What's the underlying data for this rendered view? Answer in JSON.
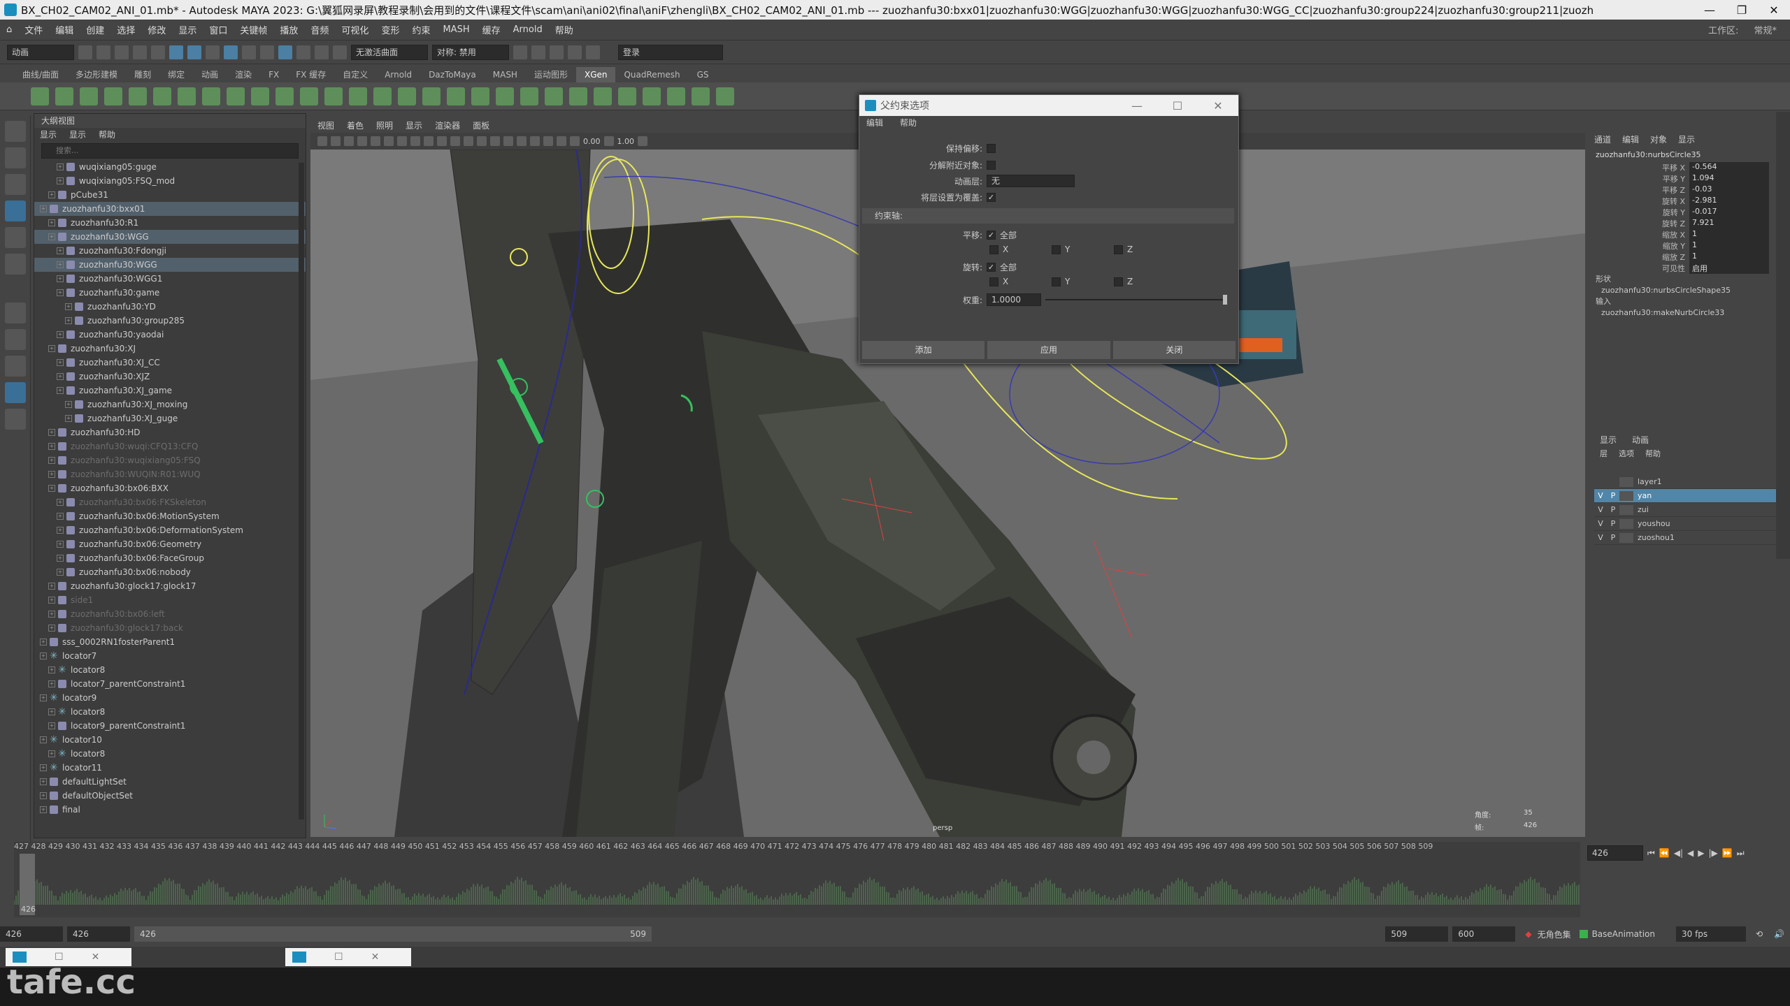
{
  "window": {
    "title": "BX_CH02_CAM02_ANI_01.mb* - Autodesk MAYA 2023: G:\\翼狐网录屏\\教程录制\\会用到的文件\\课程文件\\scam\\ani\\ani02\\final\\aniF\\zhengli\\BX_CH02_CAM02_ANI_01.mb --- zuozhanfu30:bxx01|zuozhanfu30:WGG|zuozhanfu30:WGG|zuozhanfu30:WGG_CC|zuozhanfu30:group224|zuozhanfu30:group211|zuozh",
    "controls": [
      "—",
      "❐",
      "✕"
    ]
  },
  "menubar": {
    "items": [
      "文件",
      "编辑",
      "创建",
      "选择",
      "修改",
      "显示",
      "窗口",
      "关键帧",
      "播放",
      "音频",
      "可视化",
      "变形",
      "约束",
      "MASH",
      "缓存",
      "Arnold",
      "帮助"
    ],
    "workspace_label": "工作区:",
    "workspace_value": "常规*"
  },
  "statusline": {
    "mode": "动画",
    "surface": "无激活曲面",
    "symmetry": "对称: 禁用",
    "login": "登录"
  },
  "shelf": {
    "tabs": [
      "曲线/曲面",
      "多边形建模",
      "雕刻",
      "绑定",
      "动画",
      "渲染",
      "FX",
      "FX 缓存",
      "自定义",
      "Arnold",
      "DazToMaya",
      "MASH",
      "运动图形",
      "XGen",
      "QuadRemesh",
      "GS"
    ],
    "active_tab": "XGen"
  },
  "outliner": {
    "title": "大纲视图",
    "menu": [
      "显示",
      "显示",
      "帮助"
    ],
    "search_placeholder": "搜索...",
    "items": [
      {
        "label": "wuqixiang05:guge",
        "indent": 2,
        "state": "normal"
      },
      {
        "label": "wuqixiang05:FSQ_mod",
        "indent": 2,
        "state": "normal"
      },
      {
        "label": "pCube31",
        "indent": 1,
        "state": "normal"
      },
      {
        "label": "zuozhanfu30:bxx01",
        "indent": 0,
        "state": "hl"
      },
      {
        "label": "zuozhanfu30:R1",
        "indent": 1,
        "state": "normal"
      },
      {
        "label": "zuozhanfu30:WGG",
        "indent": 1,
        "state": "hl"
      },
      {
        "label": "zuozhanfu30:Fdongji",
        "indent": 2,
        "state": "normal"
      },
      {
        "label": "zuozhanfu30:WGG",
        "indent": 2,
        "state": "hl"
      },
      {
        "label": "zuozhanfu30:WGG1",
        "indent": 2,
        "state": "normal"
      },
      {
        "label": "zuozhanfu30:game",
        "indent": 2,
        "state": "normal"
      },
      {
        "label": "zuozhanfu30:YD",
        "indent": 3,
        "state": "normal"
      },
      {
        "label": "zuozhanfu30:group285",
        "indent": 3,
        "state": "normal"
      },
      {
        "label": "zuozhanfu30:yaodai",
        "indent": 2,
        "state": "normal"
      },
      {
        "label": "zuozhanfu30:XJ",
        "indent": 1,
        "state": "normal"
      },
      {
        "label": "zuozhanfu30:XJ_CC",
        "indent": 2,
        "state": "normal"
      },
      {
        "label": "zuozhanfu30:XJZ",
        "indent": 2,
        "state": "normal"
      },
      {
        "label": "zuozhanfu30:XJ_game",
        "indent": 2,
        "state": "normal"
      },
      {
        "label": "zuozhanfu30:XJ_moxing",
        "indent": 3,
        "state": "normal"
      },
      {
        "label": "zuozhanfu30:XJ_guge",
        "indent": 3,
        "state": "normal"
      },
      {
        "label": "zuozhanfu30:HD",
        "indent": 1,
        "state": "normal"
      },
      {
        "label": "zuozhanfu30:wuqi:CFQ13:CFQ",
        "indent": 1,
        "state": "dim"
      },
      {
        "label": "zuozhanfu30:wuqixiang05:FSQ",
        "indent": 1,
        "state": "dim"
      },
      {
        "label": "zuozhanfu30:WUQIN:R01:WUQ",
        "indent": 1,
        "state": "dim"
      },
      {
        "label": "zuozhanfu30:bx06:BXX",
        "indent": 1,
        "state": "normal"
      },
      {
        "label": "zuozhanfu30:bx06:FKSkeleton",
        "indent": 2,
        "state": "dim"
      },
      {
        "label": "zuozhanfu30:bx06:MotionSystem",
        "indent": 2,
        "state": "normal"
      },
      {
        "label": "zuozhanfu30:bx06:DeformationSystem",
        "indent": 2,
        "state": "normal"
      },
      {
        "label": "zuozhanfu30:bx06:Geometry",
        "indent": 2,
        "state": "normal"
      },
      {
        "label": "zuozhanfu30:bx06:FaceGroup",
        "indent": 2,
        "state": "normal"
      },
      {
        "label": "zuozhanfu30:bx06:nobody",
        "indent": 2,
        "state": "normal"
      },
      {
        "label": "zuozhanfu30:glock17:glock17",
        "indent": 1,
        "state": "normal"
      },
      {
        "label": "side1",
        "indent": 1,
        "state": "dim"
      },
      {
        "label": "zuozhanfu30:bx06:left",
        "indent": 1,
        "state": "dim"
      },
      {
        "label": "zuozhanfu30:glock17:back",
        "indent": 1,
        "state": "dim"
      },
      {
        "label": "sss_0002RN1fosterParent1",
        "indent": 0,
        "state": "normal"
      },
      {
        "label": "locator7",
        "indent": 0,
        "state": "normal",
        "loc": true
      },
      {
        "label": "locator8",
        "indent": 1,
        "state": "normal",
        "loc": true
      },
      {
        "label": "locator7_parentConstraint1",
        "indent": 1,
        "state": "normal"
      },
      {
        "label": "locator9",
        "indent": 0,
        "state": "normal",
        "loc": true
      },
      {
        "label": "locator8",
        "indent": 1,
        "state": "normal",
        "loc": true
      },
      {
        "label": "locator9_parentConstraint1",
        "indent": 1,
        "state": "normal"
      },
      {
        "label": "locator10",
        "indent": 0,
        "state": "normal",
        "loc": true
      },
      {
        "label": "locator8",
        "indent": 1,
        "state": "normal",
        "loc": true
      },
      {
        "label": "locator11",
        "indent": 0,
        "state": "normal",
        "loc": true
      },
      {
        "label": "defaultLightSet",
        "indent": 0,
        "state": "normal"
      },
      {
        "label": "defaultObjectSet",
        "indent": 0,
        "state": "normal"
      },
      {
        "label": "final",
        "indent": 0,
        "state": "normal"
      }
    ]
  },
  "viewport": {
    "menu": [
      "视图",
      "着色",
      "照明",
      "显示",
      "渲染器",
      "面板"
    ],
    "field_a": "0.00",
    "field_b": "1.00",
    "camera": "persp",
    "hud_label_1": "角度:",
    "hud_value_1": "35",
    "hud_label_2": "帧:",
    "hud_value_2": "426"
  },
  "dialog": {
    "title": "父约束选项",
    "menu": [
      "编辑",
      "帮助"
    ],
    "maintain_offset_label": "保持偏移:",
    "decompose_label": "分解附近对象:",
    "anim_layer_label": "动画层:",
    "anim_layer_value": "无",
    "set_layer_label": "将层设置为覆盖:",
    "constraint_axes_label": "约束轴:",
    "translate_label": "平移:",
    "rotate_label": "旋转:",
    "all_label": "全部",
    "x": "X",
    "y": "Y",
    "z": "Z",
    "weight_label": "权重:",
    "weight_value": "1.0000",
    "btn_add": "添加",
    "btn_apply": "应用",
    "btn_close": "关闭"
  },
  "channelbox": {
    "menu": [
      "通道",
      "编辑",
      "对象",
      "显示"
    ],
    "object": "zuozhanfu30:nurbsCircle35",
    "attrs": [
      {
        "name": "平移 X",
        "value": "-0.564"
      },
      {
        "name": "平移 Y",
        "value": "1.094"
      },
      {
        "name": "平移 Z",
        "value": "-0.03"
      },
      {
        "name": "旋转 X",
        "value": "-2.981"
      },
      {
        "name": "旋转 Y",
        "value": "-0.017"
      },
      {
        "name": "旋转 Z",
        "value": "7.921"
      },
      {
        "name": "缩放 X",
        "value": "1"
      },
      {
        "name": "缩放 Y",
        "value": "1"
      },
      {
        "name": "缩放 Z",
        "value": "1"
      },
      {
        "name": "可见性",
        "value": "启用"
      }
    ],
    "shapes_label": "形状",
    "shape_name": "zuozhanfu30:nurbsCircleShape35",
    "inputs_label": "输入",
    "input_name": "zuozhanfu30:makeNurbCircle33"
  },
  "layers": {
    "tabs": [
      "显示",
      "动画"
    ],
    "menu": [
      "层",
      "选项",
      "帮助"
    ],
    "items": [
      {
        "v": "",
        "p": "",
        "name": "layer1",
        "on": false
      },
      {
        "v": "V",
        "p": "P",
        "name": "yan",
        "on": true
      },
      {
        "v": "V",
        "p": "P",
        "name": "zui",
        "on": false
      },
      {
        "v": "V",
        "p": "P",
        "name": "youshou",
        "on": false
      },
      {
        "v": "V",
        "p": "P",
        "name": "zuoshou1",
        "on": false
      }
    ]
  },
  "timeline": {
    "ticks": "427 428 429 430 431 432 433 434 435 436 437 438 439 440 441 442 443 444 445 446 447 448 449 450 451 452 453 454 455 456 457 458 459 460 461 462 463 464 465 466 467 468 469 470 471 472 473 474 475 476 477 478 479 480 481 482 483 484 485 486 487 488 489 490 491 492 493 494 495 496 497 498 499 500 501 502 503 504 505 506 507 508 509",
    "current": "426",
    "current_field": "426"
  },
  "range": {
    "start": "426",
    "start2": "426",
    "inner_start": "426",
    "inner_end": "509",
    "end": "509",
    "end2": "600",
    "char_set": "无角色集",
    "anim_layer": "BaseAnimation",
    "fps": "30 fps"
  },
  "watermark": "tafe.cc",
  "colors": {
    "accent": "#5285a6",
    "rig_yellow": "#e8e85a",
    "rig_blue": "#4aa8e8"
  }
}
